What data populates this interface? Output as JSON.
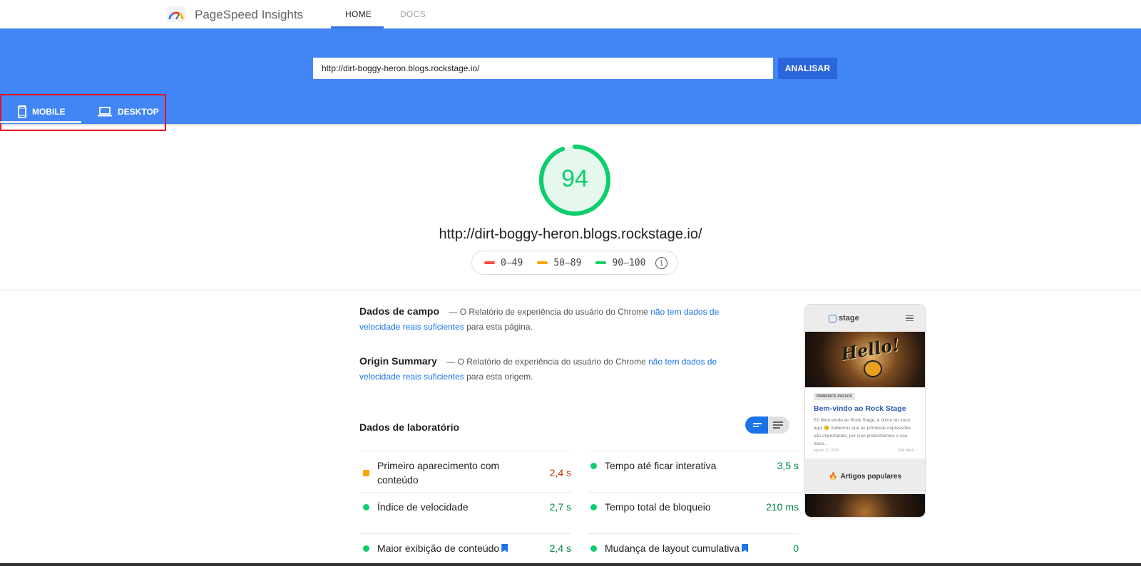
{
  "header": {
    "brand": "PageSpeed Insights",
    "tabs": [
      {
        "label": "HOME",
        "active": true
      },
      {
        "label": "DOCS",
        "active": false
      }
    ]
  },
  "search": {
    "value": "http://dirt-boggy-heron.blogs.rockstage.io/",
    "button_label": "ANALISAR"
  },
  "device_tabs": [
    {
      "label": "MOBILE",
      "icon": "smartphone-icon",
      "active": true
    },
    {
      "label": "DESKTOP",
      "icon": "laptop-icon",
      "active": false
    }
  ],
  "score": {
    "value": "94",
    "fraction": 0.94,
    "color": "#0cce6b",
    "url": "http://dirt-boggy-heron.blogs.rockstage.io/"
  },
  "legend": [
    {
      "label": "0–49",
      "color": "#ff4e42"
    },
    {
      "label": "50–89",
      "color": "#ffa400"
    },
    {
      "label": "90–100",
      "color": "#0cce6b"
    }
  ],
  "field_data": {
    "title": "Dados de campo",
    "text_before": "— O Relatório de experiência do usuário do Chrome",
    "link": "não tem dados de velocidade reais suficientes",
    "text_after": "para esta página."
  },
  "origin_summary": {
    "title": "Origin Summary",
    "text_before": "— O Relatório de experiência do usuário do Chrome",
    "link": "não tem dados de velocidade reais suficientes",
    "text_after": "para esta origem."
  },
  "lab": {
    "title": "Dados de laboratório",
    "metrics": [
      {
        "name": "Primeiro aparecimento com conteúdo",
        "value": "2,4 s",
        "status": "average"
      },
      {
        "name": "Tempo até ficar interativa",
        "value": "3,5 s",
        "status": "good"
      },
      {
        "name": "Índice de velocidade",
        "value": "2,7 s",
        "status": "good"
      },
      {
        "name": "Tempo total de bloqueio",
        "value": "210 ms",
        "status": "good"
      },
      {
        "name": "Maior exibição de conteúdo",
        "value": "2,4 s",
        "status": "good",
        "bookmark": true
      },
      {
        "name": "Mudança de layout cumulativa",
        "value": "0",
        "status": "good",
        "bookmark": true
      }
    ]
  },
  "thumbnail": {
    "logo": "stage",
    "hero_text": "Hello!",
    "tag": "PRIMEIROS PASSOS",
    "post_title": "Bem-vindo ao Rock Stage",
    "excerpt": "Eí! Bem-vindo ao Rock Stage, é ótimo ter você aqui 😊 Sabemos que as primeiras impressões são importantes, por isso preenchemos o seu novo...",
    "date": "agosto 11, 2020",
    "more": "LER MAIS ›",
    "popular": "Artigos populares"
  }
}
